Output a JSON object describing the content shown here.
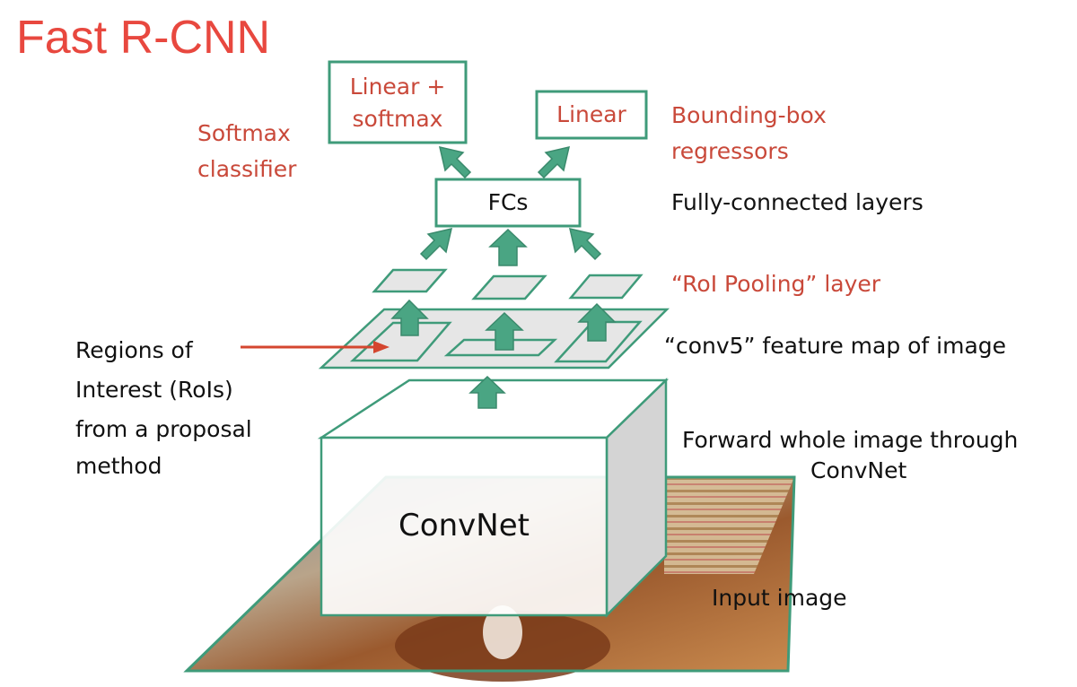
{
  "title": "Fast R-CNN",
  "colors": {
    "title": "#e8483f",
    "annotation_red": "#c9493a",
    "green": "#3f9b7a",
    "arrow_fill": "#4aa583",
    "plane_fill": "#e6e6e6",
    "pointer_arrow": "#d4462f"
  },
  "boxes": {
    "linear_softmax": "Linear +\nsoftmax",
    "linear": "Linear",
    "fcs": "FCs",
    "convnet": "ConvNet"
  },
  "labels": {
    "softmax_classifier": [
      "Softmax",
      "classifier"
    ],
    "bbox_regressors": [
      "Bounding-box",
      "regressors"
    ],
    "fc_layers": "Fully-connected layers",
    "roi_pooling": "“RoI Pooling” layer",
    "conv5": "“conv5” feature map of image",
    "rois": [
      "Regions of",
      "Interest (RoIs)",
      "from a proposal",
      "method"
    ],
    "forward": [
      "Forward whole image through",
      "ConvNet"
    ],
    "input_image": "Input image"
  }
}
